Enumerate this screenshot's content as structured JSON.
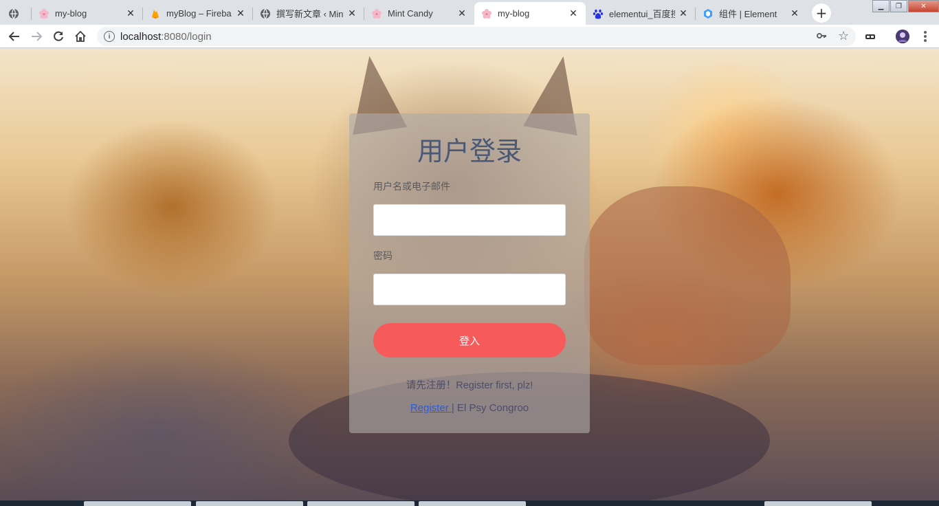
{
  "browser": {
    "tabs": [
      {
        "title": "",
        "icon": "globe-icon",
        "active": false
      },
      {
        "title": "my-blog",
        "icon": "sakura-icon",
        "active": false
      },
      {
        "title": "myBlog – Fireba",
        "icon": "firebase-icon",
        "active": false
      },
      {
        "title": "撰写新文章 ‹ Mint",
        "icon": "globe-icon",
        "active": false
      },
      {
        "title": "Mint Candy",
        "icon": "sakura-icon",
        "active": false
      },
      {
        "title": "my-blog",
        "icon": "sakura-icon",
        "active": true
      },
      {
        "title": "elementui_百度搜",
        "icon": "baidu-icon",
        "active": false
      },
      {
        "title": "组件 | Element",
        "icon": "element-icon",
        "active": false
      }
    ],
    "address": {
      "host": "localhost",
      "path": ":8080/login"
    }
  },
  "login": {
    "title": "用户登录",
    "username_label": "用户名或电子邮件",
    "username_value": "",
    "password_label": "密码",
    "password_value": "",
    "submit_label": "登入",
    "hint": "请先注册！Register first, plz!",
    "register_link": "Register ",
    "separator": "|",
    "tagline": " El Psy Congroo"
  },
  "colors": {
    "title": "#4a5878",
    "button": "#f65a5a",
    "link": "#2b5bd7"
  }
}
